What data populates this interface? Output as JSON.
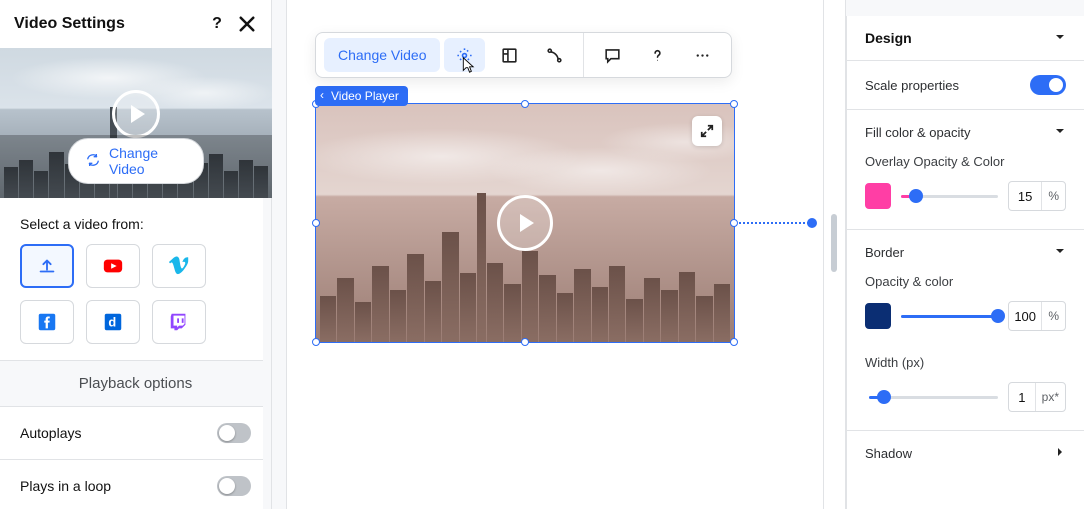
{
  "left_panel": {
    "title": "Video Settings",
    "change_video_button": "Change Video",
    "select_from_label": "Select a video from:",
    "sources": [
      "upload",
      "youtube",
      "vimeo",
      "facebook",
      "dailymotion",
      "twitch"
    ],
    "playback_section_title": "Playback options",
    "options": [
      {
        "label": "Autoplays",
        "on": false
      },
      {
        "label": "Plays in a loop",
        "on": false
      }
    ]
  },
  "toolbar": {
    "change_video_label": "Change Video"
  },
  "selection_chip": "Video Player",
  "right_panel": {
    "header": "Design",
    "scale_properties_label": "Scale properties",
    "scale_properties_on": true,
    "fill_section": "Fill color & opacity",
    "overlay_label": "Overlay Opacity & Color",
    "overlay_value": "15",
    "overlay_unit": "%",
    "border_section": "Border",
    "opacity_label": "Opacity & color",
    "opacity_value": "100",
    "opacity_unit": "%",
    "width_label": "Width (px)",
    "width_value": "1",
    "width_unit": "px*",
    "shadow_section": "Shadow"
  }
}
